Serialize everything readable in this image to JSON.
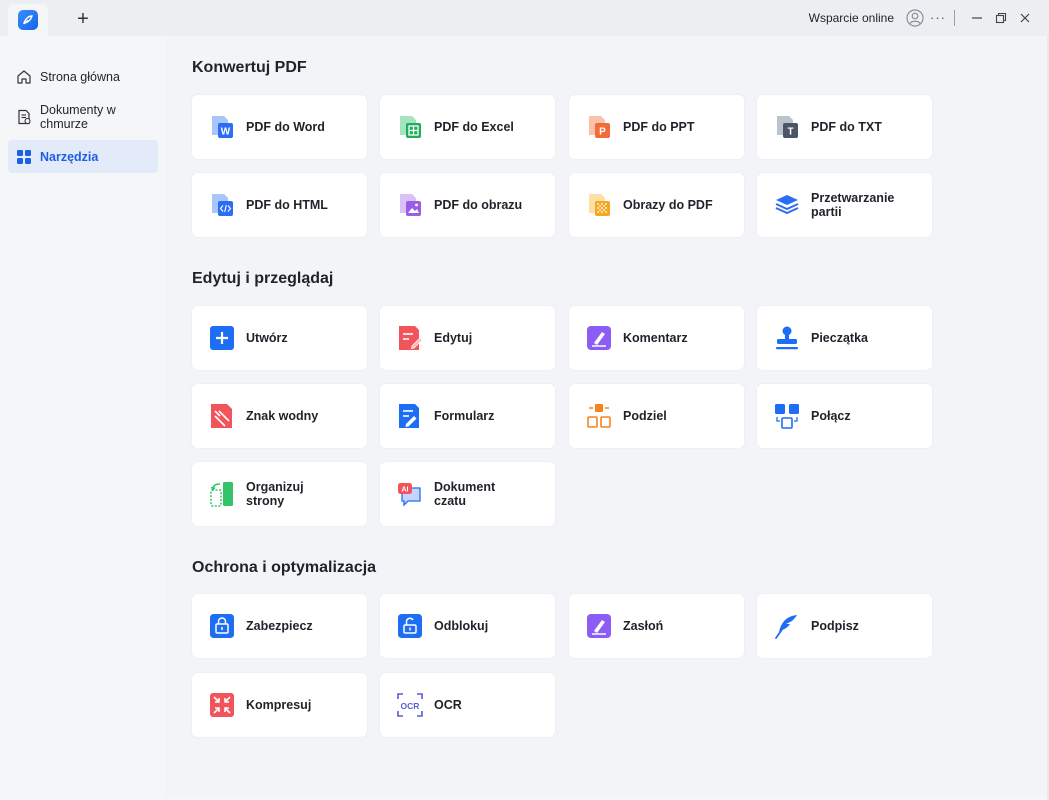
{
  "titlebar": {
    "new_tab_symbol": "+",
    "support_label": "Wsparcie online",
    "more_symbol": "···"
  },
  "sidebar": {
    "items": [
      {
        "label": "Strona główna",
        "icon": "home-icon",
        "active": false
      },
      {
        "label": "Dokumenty w chmurze",
        "icon": "cloud-document-icon",
        "active": false
      },
      {
        "label": "Narzędzia",
        "icon": "tools-grid-icon",
        "active": true
      }
    ]
  },
  "sections": [
    {
      "title": "Konwertuj PDF",
      "cards": [
        {
          "label": "PDF do Word",
          "icon": "pdf-to-word-icon"
        },
        {
          "label": "PDF do Excel",
          "icon": "pdf-to-excel-icon"
        },
        {
          "label": "PDF do PPT",
          "icon": "pdf-to-ppt-icon"
        },
        {
          "label": "PDF do TXT",
          "icon": "pdf-to-txt-icon"
        },
        {
          "label": "PDF do HTML",
          "icon": "pdf-to-html-icon"
        },
        {
          "label": "PDF do obrazu",
          "icon": "pdf-to-image-icon"
        },
        {
          "label": "Obrazy do PDF",
          "icon": "images-to-pdf-icon"
        },
        {
          "label": "Przetwarzanie partii",
          "icon": "batch-layers-icon"
        }
      ]
    },
    {
      "title": "Edytuj i przeglądaj",
      "cards": [
        {
          "label": "Utwórz",
          "icon": "create-plus-icon"
        },
        {
          "label": "Edytuj",
          "icon": "edit-document-icon"
        },
        {
          "label": "Komentarz",
          "icon": "comment-pen-icon"
        },
        {
          "label": "Pieczątka",
          "icon": "stamp-icon"
        },
        {
          "label": "Znak wodny",
          "icon": "watermark-icon"
        },
        {
          "label": "Formularz",
          "icon": "form-icon"
        },
        {
          "label": "Podziel",
          "icon": "split-icon"
        },
        {
          "label": "Połącz",
          "icon": "merge-icon"
        },
        {
          "label": "Organizuj strony",
          "icon": "organize-pages-icon"
        },
        {
          "label": "Dokument czatu",
          "icon": "ai-chat-icon"
        }
      ]
    },
    {
      "title": "Ochrona i optymalizacja",
      "cards": [
        {
          "label": "Zabezpiecz",
          "icon": "lock-icon"
        },
        {
          "label": "Odblokuj",
          "icon": "unlock-icon"
        },
        {
          "label": "Zasłoń",
          "icon": "redact-icon"
        },
        {
          "label": "Podpisz",
          "icon": "sign-feather-icon"
        },
        {
          "label": "Kompresuj",
          "icon": "compress-icon"
        },
        {
          "label": "OCR",
          "icon": "ocr-icon"
        }
      ]
    }
  ],
  "colors": {
    "accent": "#1d5fe3",
    "word": "#2b6ef5",
    "excel": "#1fae5b",
    "ppt": "#f26b3a",
    "txt": "#4a5568",
    "image": "#9b5de5",
    "images_to_pdf": "#f5a623",
    "red": "#f2545b",
    "purple": "#8b5cf6"
  }
}
